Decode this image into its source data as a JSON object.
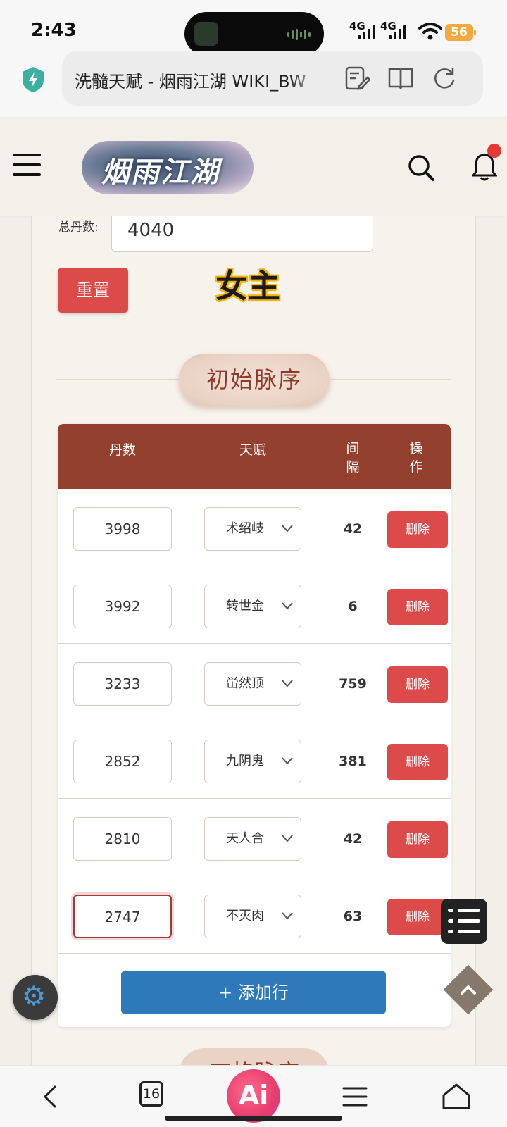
{
  "status_bar": {
    "time": "2:43",
    "network_1": "4G",
    "network_2": "4G",
    "battery": "56"
  },
  "browser": {
    "url_title": "洗髓天赋 - 烟雨江湖 WIKI_BW",
    "tab_count": "16",
    "ai_label": "Ai"
  },
  "site": {
    "logo_text": "烟雨江湖"
  },
  "form": {
    "total_label": "总丹数:",
    "total_value": "4040",
    "reset_label": "重置"
  },
  "overlay_label": "女主",
  "section": {
    "title": "初始脉序",
    "next_title": "四格脉序"
  },
  "table": {
    "headers": {
      "dan": "丹数",
      "talent": "天赋",
      "interval": "间隔",
      "action": "操作"
    },
    "rows": [
      {
        "dan": "3998",
        "talent": "术绍岐",
        "interval": "42",
        "action": "删除"
      },
      {
        "dan": "3992",
        "talent": "转世金",
        "interval": "6",
        "action": "删除"
      },
      {
        "dan": "3233",
        "talent": "峃然顶",
        "interval": "759",
        "action": "删除"
      },
      {
        "dan": "2852",
        "talent": "九阴鬼",
        "interval": "381",
        "action": "删除"
      },
      {
        "dan": "2810",
        "talent": "天人合",
        "interval": "42",
        "action": "删除"
      },
      {
        "dan": "2747",
        "talent": "不灭肉",
        "interval": "63",
        "action": "删除"
      }
    ],
    "add_row_label": "+ 添加行"
  },
  "colors": {
    "header_bg": "#94402e",
    "delete_bg": "#dc4a4a",
    "add_bg": "#2e79b9",
    "section_text": "#8e3b2b"
  }
}
